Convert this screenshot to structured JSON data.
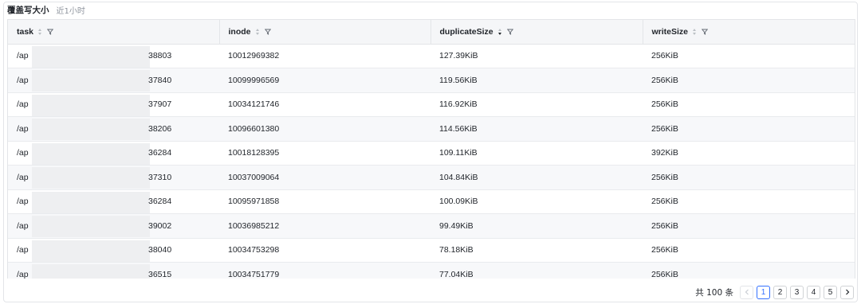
{
  "panel": {
    "title": "覆盖写大小",
    "subtitle": "近1小时"
  },
  "table": {
    "columns": [
      {
        "key": "task",
        "label": "task",
        "sort": "none"
      },
      {
        "key": "inode",
        "label": "inode",
        "sort": "none"
      },
      {
        "key": "duplicateSize",
        "label": "duplicateSize",
        "sort": "descend"
      },
      {
        "key": "writeSize",
        "label": "writeSize",
        "sort": "none"
      }
    ],
    "rows": [
      {
        "task_prefix": "/ap",
        "task_suffix": "38803",
        "inode": "10012969382",
        "duplicateSize": "127.39KiB",
        "writeSize": "256KiB"
      },
      {
        "task_prefix": "/ap",
        "task_suffix": "37840",
        "inode": "10099996569",
        "duplicateSize": "119.56KiB",
        "writeSize": "256KiB"
      },
      {
        "task_prefix": "/ap",
        "task_suffix": "37907",
        "inode": "10034121746",
        "duplicateSize": "116.92KiB",
        "writeSize": "256KiB"
      },
      {
        "task_prefix": "/ap",
        "task_suffix": "38206",
        "inode": "10096601380",
        "duplicateSize": "114.56KiB",
        "writeSize": "256KiB"
      },
      {
        "task_prefix": "/ap",
        "task_suffix": "36284",
        "inode": "10018128395",
        "duplicateSize": "109.11KiB",
        "writeSize": "392KiB"
      },
      {
        "task_prefix": "/ap",
        "task_suffix": "37310",
        "inode": "10037009064",
        "duplicateSize": "104.84KiB",
        "writeSize": "256KiB"
      },
      {
        "task_prefix": "/ap",
        "task_suffix": "36284",
        "inode": "10095971858",
        "duplicateSize": "100.09KiB",
        "writeSize": "256KiB"
      },
      {
        "task_prefix": "/ap",
        "task_suffix": "39002",
        "inode": "10036985212",
        "duplicateSize": "99.49KiB",
        "writeSize": "256KiB"
      },
      {
        "task_prefix": "/ap",
        "task_suffix": "38040",
        "inode": "10034753298",
        "duplicateSize": "78.18KiB",
        "writeSize": "256KiB"
      },
      {
        "task_prefix": "/ap",
        "task_suffix": "36515",
        "inode": "10034751779",
        "duplicateSize": "77.04KiB",
        "writeSize": "256KiB"
      }
    ]
  },
  "pagination": {
    "total_label": "共 100 条",
    "prev_icon": "chevron-left-icon",
    "next_icon": "chevron-right-icon",
    "pages": [
      "1",
      "2",
      "3",
      "4",
      "5"
    ],
    "current_page": "1",
    "accent_color": "#3370ff"
  }
}
